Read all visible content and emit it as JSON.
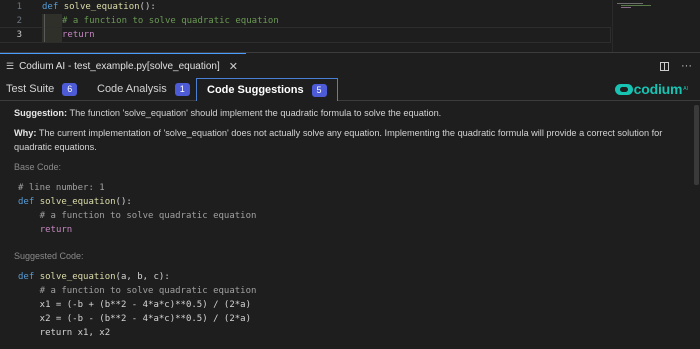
{
  "editor": {
    "line_numbers": [
      "1",
      "2",
      "3"
    ],
    "line1_kw": "def",
    "line1_fn": "solve_equation",
    "line1_rest": "():",
    "line2_comment": "# a function to solve quadratic equation",
    "line3_kw": "return"
  },
  "panel": {
    "title": "Codium AI - test_example.py[solve_equation]",
    "icon": "list-icon"
  },
  "tabs": [
    {
      "label": "Test Suite",
      "count": "6"
    },
    {
      "label": "Code Analysis",
      "count": "1"
    },
    {
      "label": "Code Suggestions",
      "count": "5"
    }
  ],
  "logo": {
    "text": "codium",
    "sup": "AI"
  },
  "suggestion": {
    "label": "Suggestion:",
    "text": " The function 'solve_equation' should implement the quadratic formula to solve the equation."
  },
  "why": {
    "label": "Why:",
    "text": " The current implementation of 'solve_equation' does not actually solve any equation. Implementing the quadratic formula will provide a correct solution for quadratic equations."
  },
  "base_code": {
    "label": "Base Code:",
    "lines": [
      "# line number: 1",
      "def solve_equation():",
      "    # a function to solve quadratic equation",
      "    return"
    ]
  },
  "suggested_code": {
    "label": "Suggested Code:",
    "lines": [
      "def solve_equation(a, b, c):",
      "    # a function to solve quadratic equation",
      "    x1 = (-b + (b**2 - 4*a*c)**0.5) / (2*a)",
      "    x2 = (-b - (b**2 - 4*a*c)**0.5) / (2*a)",
      "    return x1, x2"
    ]
  },
  "colors": {
    "accent": "#4a7fd6",
    "badge": "#4d5bd6",
    "brand": "#17c3b2",
    "keyword": "#569cd6",
    "function": "#dcdcaa",
    "comment": "#6a9955",
    "control": "#c586c0"
  }
}
